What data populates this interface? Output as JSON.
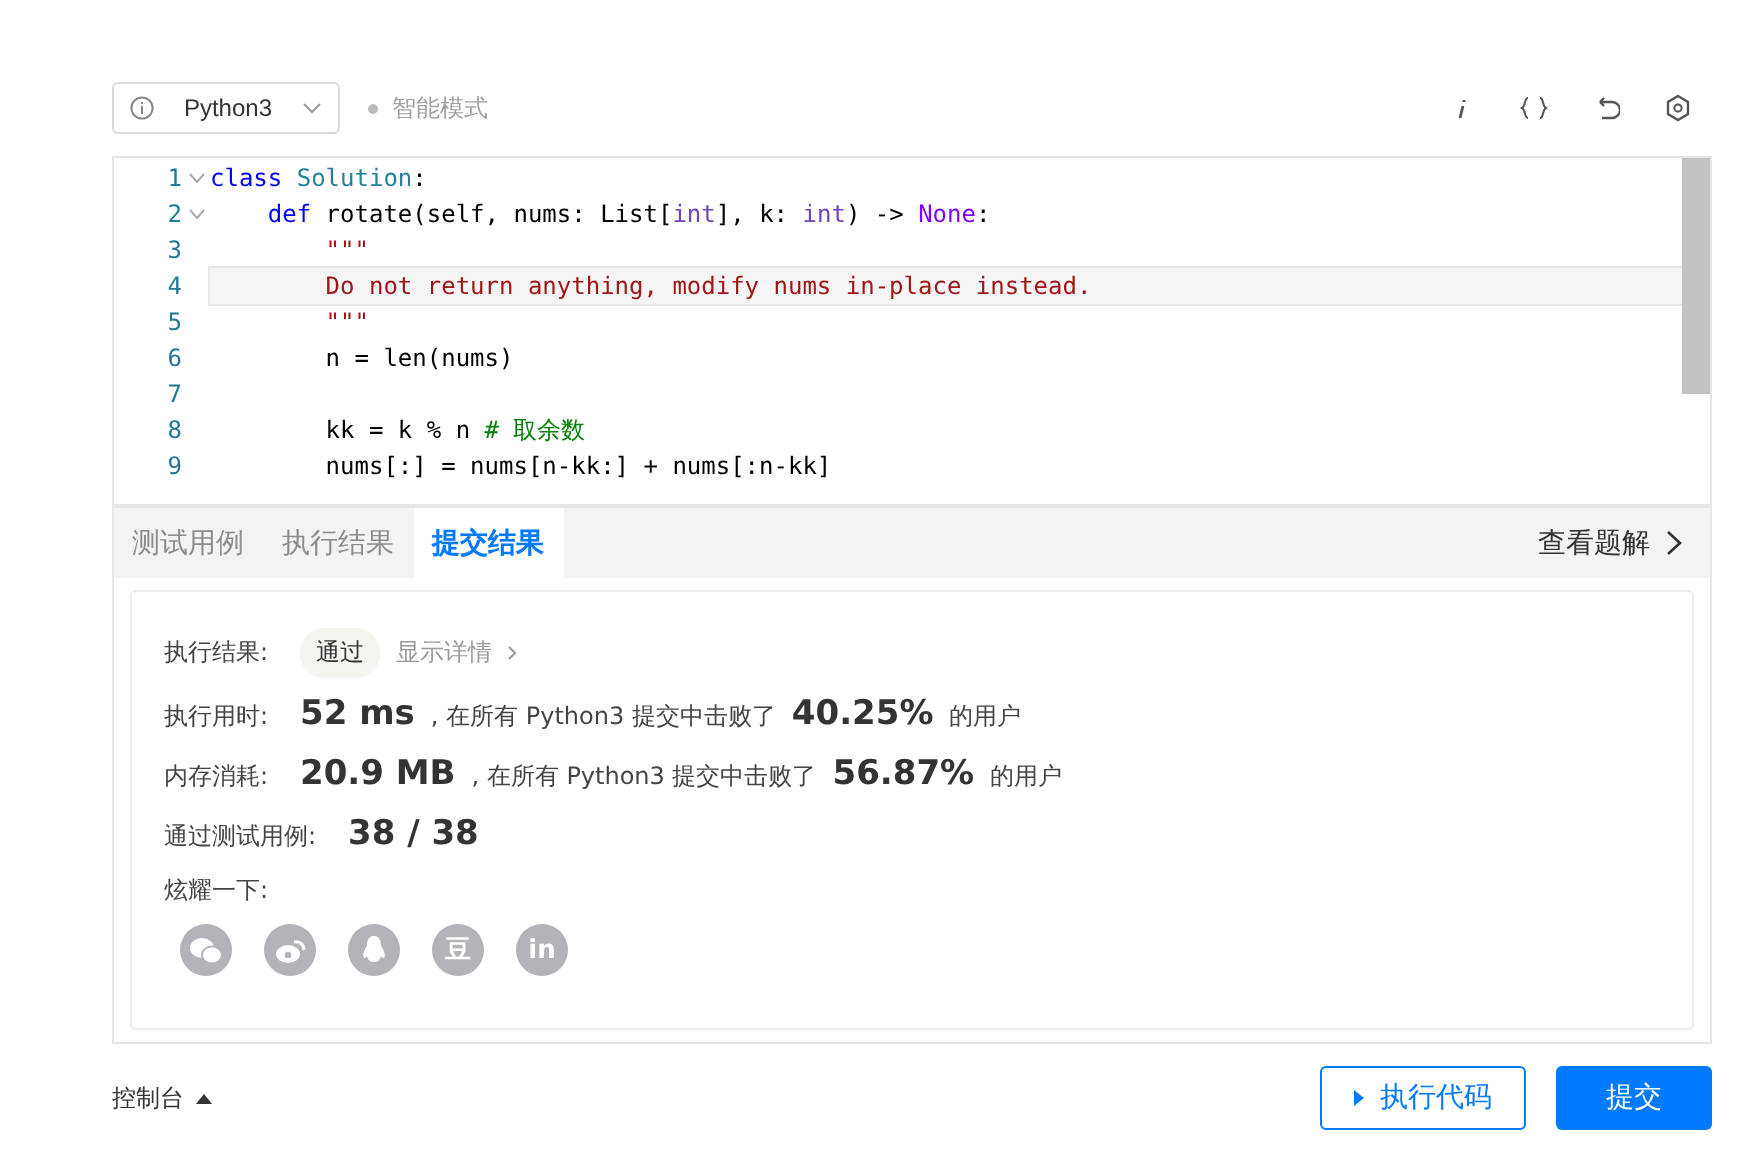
{
  "toolbar": {
    "language": "Python3",
    "mode": "智能模式"
  },
  "editor": {
    "lines": [
      {
        "number": "1",
        "foldable": true,
        "current": false,
        "tokens": [
          {
            "kind": "keyword",
            "text": "class"
          },
          {
            "kind": "name",
            "text": " Solution"
          },
          {
            "kind": "plain",
            "text": ":"
          }
        ]
      },
      {
        "number": "2",
        "foldable": true,
        "current": false,
        "tokens": [
          {
            "kind": "keyword",
            "text": "    def"
          },
          {
            "kind": "plain",
            "text": " rotate(self, nums: List["
          },
          {
            "kind": "type",
            "text": "int"
          },
          {
            "kind": "plain",
            "text": "], k: "
          },
          {
            "kind": "type",
            "text": "int"
          },
          {
            "kind": "plain",
            "text": ") -> "
          },
          {
            "kind": "constant",
            "text": "None"
          },
          {
            "kind": "plain",
            "text": ":"
          }
        ]
      },
      {
        "number": "3",
        "foldable": false,
        "current": false,
        "tokens": [
          {
            "kind": "string",
            "text": "        \"\"\""
          }
        ]
      },
      {
        "number": "4",
        "foldable": false,
        "current": true,
        "tokens": [
          {
            "kind": "string",
            "text": "        Do not return anything, modify nums in-place instead."
          }
        ]
      },
      {
        "number": "5",
        "foldable": false,
        "current": false,
        "tokens": [
          {
            "kind": "string",
            "text": "        \"\"\""
          }
        ]
      },
      {
        "number": "6",
        "foldable": false,
        "current": false,
        "tokens": [
          {
            "kind": "plain",
            "text": "        n = len(nums)"
          }
        ]
      },
      {
        "number": "7",
        "foldable": false,
        "current": false
      },
      {
        "number": "8",
        "foldable": false,
        "current": false,
        "tokens": [
          {
            "kind": "plain",
            "text": "        kk = k % n "
          },
          {
            "kind": "comment",
            "text": "# 取余数"
          }
        ]
      },
      {
        "number": "9",
        "foldable": false,
        "current": false,
        "tokens": [
          {
            "kind": "plain",
            "text": "        nums[:] = nums[n-kk:] + nums[:n-kk]"
          }
        ]
      }
    ]
  },
  "tabs": [
    {
      "label": "测试用例",
      "selected": false
    },
    {
      "label": "执行结果",
      "selected": false
    },
    {
      "label": "提交结果",
      "selected": true
    }
  ],
  "solution_link": "查看题解",
  "result": {
    "status_label": "执行结果:",
    "status": "通过",
    "details_link": "显示详情",
    "stats": [
      {
        "label": "执行用时:",
        "value": "52 ms",
        "text": ", 在所有 Python3 提交中击败了",
        "percent": "40.25%",
        "suffix": "的用户"
      },
      {
        "label": "内存消耗:",
        "value": "20.9 MB",
        "text": ", 在所有 Python3 提交中击败了",
        "percent": "56.87%",
        "suffix": "的用户"
      }
    ],
    "cases_label": "通过测试用例:",
    "cases": "38 / 38",
    "share_label": "炫耀一下:",
    "share_buttons": [
      {
        "kind": "chat"
      },
      {
        "kind": "swirl"
      },
      {
        "kind": "penguin"
      },
      {
        "kind": "text",
        "label": "豆"
      },
      {
        "kind": "text",
        "label": "in"
      }
    ]
  },
  "console": "控制台",
  "run_button": "执行代码",
  "submit_button": "提交"
}
